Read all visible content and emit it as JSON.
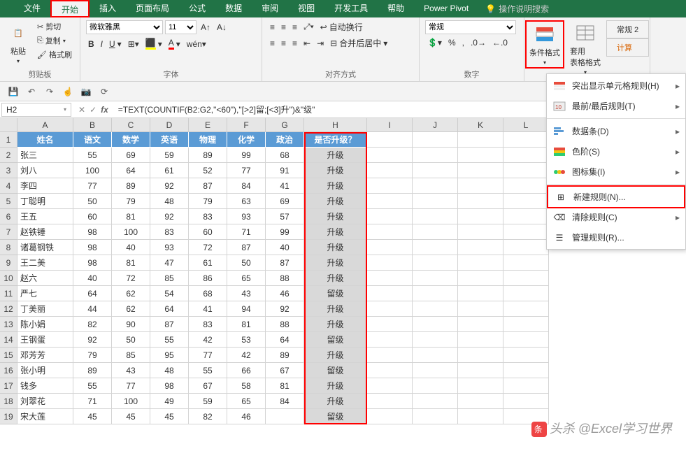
{
  "tabs": [
    "文件",
    "开始",
    "插入",
    "页面布局",
    "公式",
    "数据",
    "审阅",
    "视图",
    "开发工具",
    "帮助",
    "Power Pivot"
  ],
  "active_tab_index": 1,
  "tell_me": "操作说明搜索",
  "ribbon": {
    "clipboard": {
      "label": "剪贴板",
      "paste": "粘贴",
      "cut": "剪切",
      "copy": "复制",
      "format_painter": "格式刷"
    },
    "font": {
      "label": "字体",
      "name": "微软雅黑",
      "size": "11"
    },
    "align": {
      "label": "对齐方式",
      "wrap": "自动换行",
      "merge": "合并后居中"
    },
    "number": {
      "label": "数字",
      "format": "常规"
    },
    "cond_format": "条件格式",
    "table_format": "套用\n表格格式",
    "styles": {
      "normal2": "常规 2",
      "calc": "计算"
    }
  },
  "cf_menu": {
    "highlight_rules": "突出显示单元格规则(H)",
    "top_bottom": "最前/最后规则(T)",
    "data_bars": "数据条(D)",
    "color_scales": "色阶(S)",
    "icon_sets": "图标集(I)",
    "new_rule": "新建规则(N)...",
    "clear_rules": "清除规则(C)",
    "manage_rules": "管理规则(R)..."
  },
  "name_box": "H2",
  "formula": "=TEXT(COUNTIF(B2:G2,\"<60\"),\"[>2]留;[<3]升\")&\"级\"",
  "columns": [
    "A",
    "B",
    "C",
    "D",
    "E",
    "F",
    "G",
    "H",
    "I",
    "J",
    "K",
    "L"
  ],
  "headers": [
    "姓名",
    "语文",
    "数学",
    "英语",
    "物理",
    "化学",
    "政治",
    "是否升级？"
  ],
  "rows": [
    [
      "张三",
      "55",
      "69",
      "59",
      "89",
      "99",
      "68",
      "升级"
    ],
    [
      "刘八",
      "100",
      "64",
      "61",
      "52",
      "77",
      "91",
      "升级"
    ],
    [
      "李四",
      "77",
      "89",
      "92",
      "87",
      "84",
      "41",
      "升级"
    ],
    [
      "丁聪明",
      "50",
      "79",
      "48",
      "79",
      "63",
      "69",
      "升级"
    ],
    [
      "王五",
      "60",
      "81",
      "92",
      "83",
      "93",
      "57",
      "升级"
    ],
    [
      "赵铁锤",
      "98",
      "100",
      "83",
      "60",
      "71",
      "99",
      "升级"
    ],
    [
      "诸葛钢铁",
      "98",
      "40",
      "93",
      "72",
      "87",
      "40",
      "升级"
    ],
    [
      "王二美",
      "98",
      "81",
      "47",
      "61",
      "50",
      "87",
      "升级"
    ],
    [
      "赵六",
      "40",
      "72",
      "85",
      "86",
      "65",
      "88",
      "升级"
    ],
    [
      "严七",
      "64",
      "62",
      "54",
      "68",
      "43",
      "46",
      "留级"
    ],
    [
      "丁美丽",
      "44",
      "62",
      "64",
      "41",
      "94",
      "92",
      "升级"
    ],
    [
      "陈小娟",
      "82",
      "90",
      "87",
      "83",
      "81",
      "88",
      "升级"
    ],
    [
      "王钢蛋",
      "92",
      "50",
      "55",
      "42",
      "53",
      "64",
      "留级"
    ],
    [
      "邓芳芳",
      "79",
      "85",
      "95",
      "77",
      "42",
      "89",
      "升级"
    ],
    [
      "张小明",
      "89",
      "43",
      "48",
      "55",
      "66",
      "67",
      "留级"
    ],
    [
      "钱多",
      "55",
      "77",
      "98",
      "67",
      "58",
      "81",
      "升级"
    ],
    [
      "刘翠花",
      "71",
      "100",
      "49",
      "59",
      "65",
      "84",
      "升级"
    ],
    [
      "宋大莲",
      "45",
      "45",
      "45",
      "82",
      "46",
      "",
      "留级"
    ]
  ],
  "watermark": "头杀 @Excel学习世界"
}
